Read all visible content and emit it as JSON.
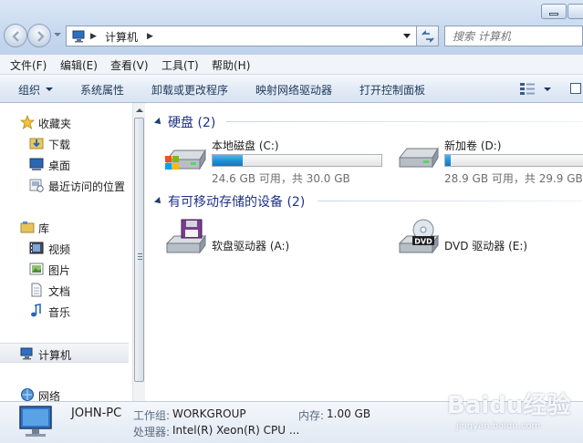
{
  "address": {
    "crumb": "计算机"
  },
  "search": {
    "placeholder": "搜索 计算机"
  },
  "menu": [
    "文件(F)",
    "编辑(E)",
    "查看(V)",
    "工具(T)",
    "帮助(H)"
  ],
  "commands": {
    "organize": "组织",
    "system_properties": "系统属性",
    "uninstall": "卸载或更改程序",
    "map_drive": "映射网络驱动器",
    "control_panel": "打开控制面板"
  },
  "nav": {
    "favorites": "收藏夹",
    "downloads": "下载",
    "desktop": "桌面",
    "recent": "最近访问的位置",
    "libraries": "库",
    "videos": "视频",
    "pictures": "图片",
    "documents": "文档",
    "music": "音乐",
    "computer": "计算机",
    "network": "网络"
  },
  "groups": {
    "hard_disks": "硬盘 (2)",
    "removable": "有可移动存储的设备 (2)"
  },
  "drives": [
    {
      "name": "本地磁盘 (C:)",
      "info": "24.6 GB 可用，共 30.0 GB",
      "used_fraction": 0.18
    },
    {
      "name": "新加卷 (D:)",
      "info": "28.9 GB 可用，共 29.9 GB",
      "used_fraction": 0.04
    }
  ],
  "devices": [
    {
      "name": "软盘驱动器 (A:)"
    },
    {
      "name": "DVD 驱动器 (E:)"
    }
  ],
  "dvd_label": "DVD",
  "details": {
    "pc_name": "JOHN-PC",
    "workgroup_key": "工作组:",
    "workgroup_val": "WORKGROUP",
    "memory_key": "内存:",
    "memory_val": "1.00 GB",
    "cpu_key": "处理器:",
    "cpu_val": "Intel(R) Xeon(R) CPU ..."
  },
  "watermark": {
    "brand": "Baidu经验",
    "url": "jingyan.baidu.com"
  },
  "colors": {
    "accent": "#1e3287",
    "bar_fill": "#1f8fd6",
    "cmdbar": "#dde7f3"
  }
}
